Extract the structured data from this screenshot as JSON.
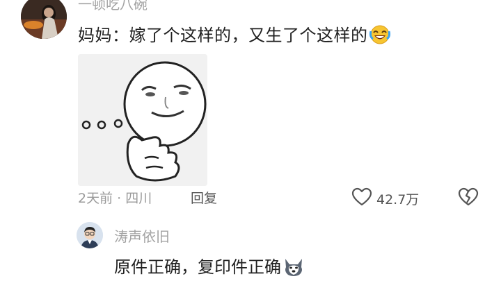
{
  "comment": {
    "author": "一顿吃八碗",
    "text": "妈妈：嫁了个这样的，又生了个这样的",
    "emoji": "rolling-laughing-emoji",
    "image": "thinking-meme-face",
    "time_location": "2天前 · 四川",
    "reply_label": "回复",
    "like_count": "42.7万",
    "icons": {
      "like": "heart-outline-icon",
      "dislike": "broken-heart-icon"
    }
  },
  "reply": {
    "author": "涛声依旧",
    "text": "原件正确，复印件正确",
    "emoji": "husky-dog-emoji"
  },
  "colors": {
    "text": "#1f1f1f",
    "meta": "#9a9a9a",
    "icon": "#555555"
  }
}
